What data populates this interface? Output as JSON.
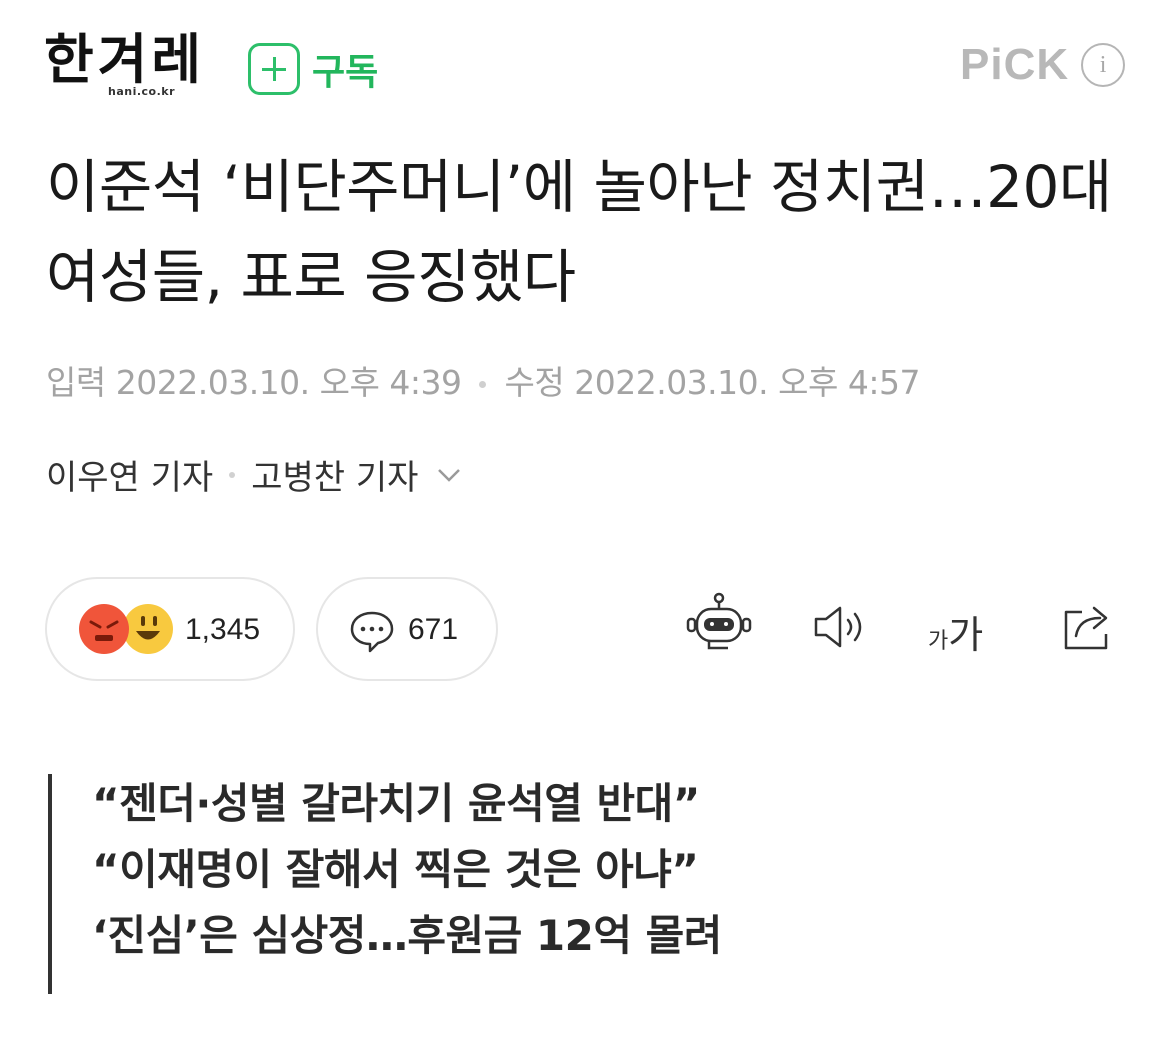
{
  "brand": {
    "logo_text": "한겨레",
    "logo_domain": "hani.co.kr",
    "subscribe_label": "구독",
    "pick_label": "PiCK",
    "info_icon": "info-icon"
  },
  "article": {
    "headline": "이준석 ‘비단주머니’에 놀아난 정치권…20대 여성들, 표로 응징했다",
    "input_label": "입력",
    "input_time": "2022.03.10. 오후 4:39",
    "edit_label": "수정",
    "edit_time": "2022.03.10. 오후 4:57",
    "reporters": [
      "이우연 기자",
      "고병찬 기자"
    ]
  },
  "actions": {
    "reaction_count": "1,345",
    "comment_count": "671",
    "font_size_label_small": "가",
    "font_size_label_large": "가",
    "icons": [
      "angry-emoji-icon",
      "smile-emoji-icon",
      "comment-icon",
      "robot-summary-icon",
      "speaker-icon",
      "share-icon"
    ]
  },
  "subtitles": [
    "“젠더·성별 갈라치기 윤석열 반대”",
    "“이재명이 잘해서 찍은 것은 아냐”",
    "‘진심’은 심상정…후원금 12억 몰려"
  ],
  "colors": {
    "accent_green": "#2dbf6a",
    "meta_gray": "#a3a3a3",
    "angry": "#f0553a",
    "smile": "#f8c93f"
  }
}
